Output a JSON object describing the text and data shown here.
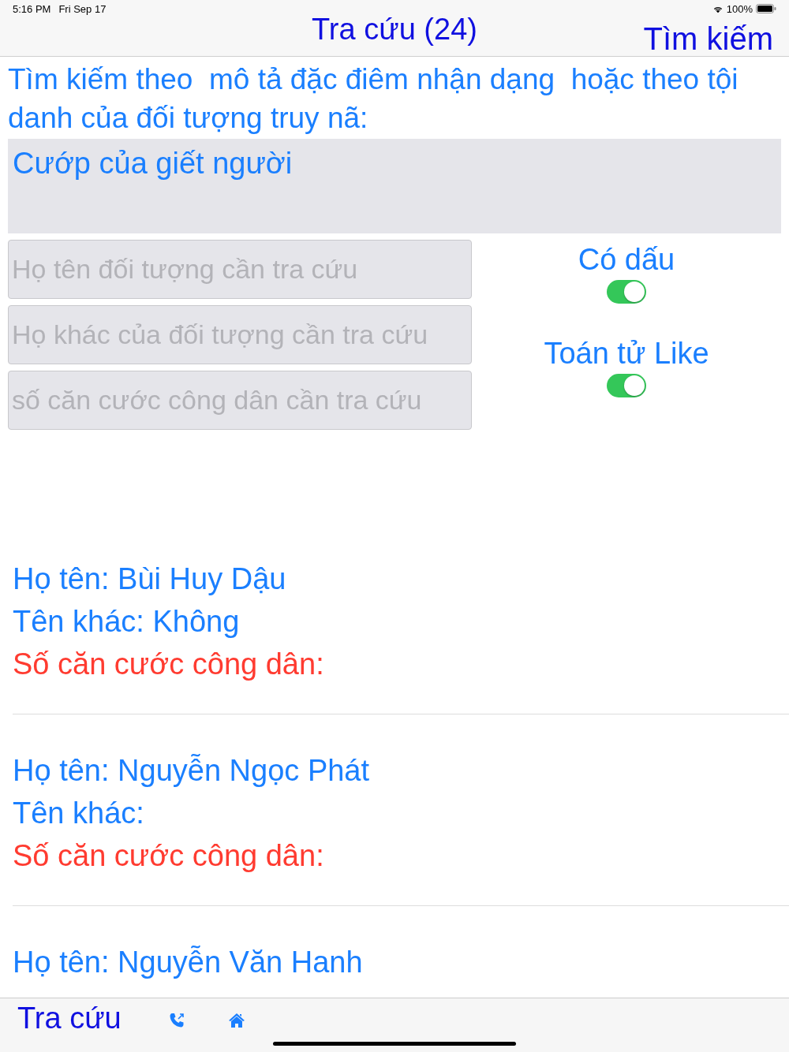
{
  "status_bar": {
    "time": "5:16 PM",
    "date": "Fri Sep 17",
    "battery": "100%"
  },
  "nav_bar": {
    "title": "Tra cứu (24)",
    "action": "Tìm kiếm"
  },
  "search": {
    "label": "Tìm kiếm theo  mô tả đặc điêm nhận dạng  hoặc theo tội danh của đối tượng truy nã:",
    "query": "Cướp của giết người",
    "fields": [
      {
        "placeholder": "Họ tên đối tượng cần tra cứu"
      },
      {
        "placeholder": "Họ khác của đối tượng cần tra cứu"
      },
      {
        "placeholder": "số căn cước công dân cần tra cứu"
      }
    ],
    "options": [
      {
        "label": "Có dấu",
        "on": true
      },
      {
        "label": "Toán tử Like",
        "on": true
      }
    ]
  },
  "results": [
    {
      "name_line": "Họ tên: Bùi Huy Dậu",
      "alias_line": "Tên khác: Không",
      "id_line": "Số căn cước công dân:"
    },
    {
      "name_line": "Họ tên: Nguyễn Ngọc Phát",
      "alias_line": "Tên khác:",
      "id_line": "Số căn cước công dân:"
    },
    {
      "name_line": "Họ tên: Nguyễn Văn Hanh"
    }
  ],
  "tab_bar": {
    "label": "Tra cứu"
  }
}
